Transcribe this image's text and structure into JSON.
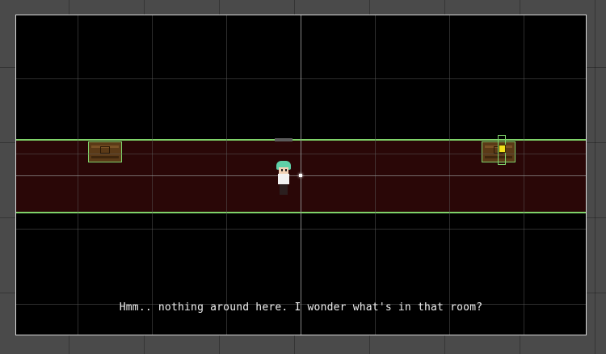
{
  "scene": {
    "dialogue_text": "Hmm.. nothing around here. I wonder what's in that room?"
  },
  "objects": {
    "chest_left": "chest",
    "chest_right": "chest",
    "trigger": "collider-box",
    "key": "key-icon",
    "player": "player-character",
    "door_marker": "door-marker"
  },
  "colors": {
    "hallway_floor": "#2a0707",
    "collider_outline": "#7fd36a",
    "editor_background": "#4a4a4a",
    "game_background": "#000000",
    "dialogue_text": "#f0f0f0",
    "player_hair": "#5fd0a8",
    "key_yellow": "#f2e01b"
  }
}
